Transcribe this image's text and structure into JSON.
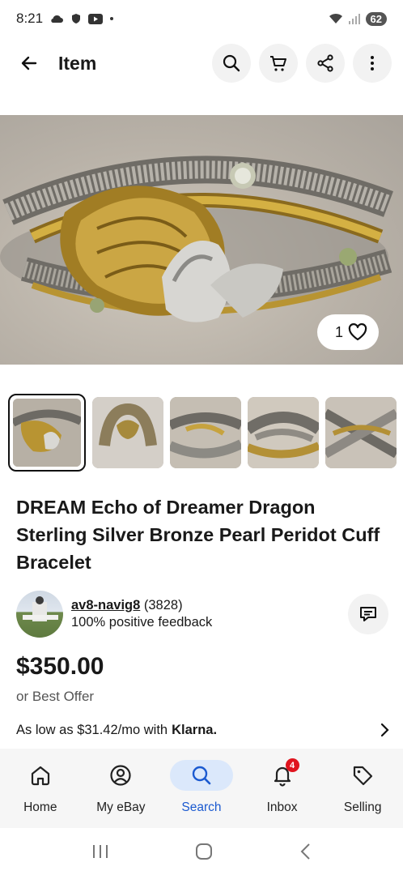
{
  "status_bar": {
    "time": "8:21",
    "battery": "62"
  },
  "app_bar": {
    "title": "Item"
  },
  "hero": {
    "like_count": "1"
  },
  "item": {
    "title": "DREAM Echo of Dreamer Dragon Sterling Silver Bronze Pearl Peridot Cuff Bracelet"
  },
  "seller": {
    "name": "av8-navig8",
    "score": "(3828)",
    "feedback": "100% positive feedback"
  },
  "pricing": {
    "price": "$350.00",
    "offer": "or Best Offer",
    "financing": "As low as $31.42/mo with",
    "financing_brand": "Klarna."
  },
  "bottom_nav": {
    "items": [
      {
        "label": "Home",
        "icon": "home-icon"
      },
      {
        "label": "My eBay",
        "icon": "user-circle-icon"
      },
      {
        "label": "Search",
        "icon": "search-icon"
      },
      {
        "label": "Inbox",
        "icon": "bell-icon",
        "badge": "4"
      },
      {
        "label": "Selling",
        "icon": "tag-icon"
      }
    ],
    "active": "Search"
  },
  "colors": {
    "accent": "#1b5ad0",
    "accent_bg": "#dbe8fb",
    "badge": "#e0141e"
  }
}
